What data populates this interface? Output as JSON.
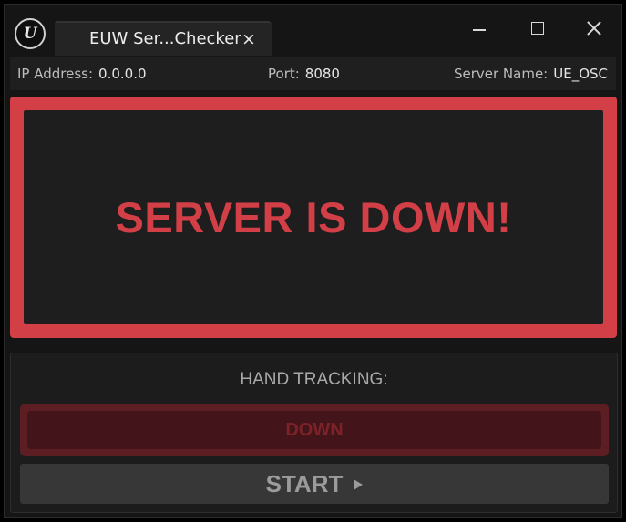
{
  "window": {
    "tab_title": "EUW Ser...Checker",
    "tab_close": "×",
    "logo_letter": "U"
  },
  "info": {
    "ip_label": "IP Address:",
    "ip_value": "0.0.0.0",
    "port_label": "Port:",
    "port_value": "8080",
    "server_name_label": "Server Name:",
    "server_name_value": "UE_OSC"
  },
  "status": {
    "message": "SERVER IS DOWN!",
    "color": "#d33f47"
  },
  "tracking": {
    "label": "HAND TRACKING:",
    "state_button": "DOWN",
    "start_button": "START"
  },
  "icons": {
    "logo": "unreal-engine-icon",
    "minimize": "minimize-icon",
    "maximize": "maximize-icon",
    "close": "close-icon",
    "play": "play-icon"
  }
}
